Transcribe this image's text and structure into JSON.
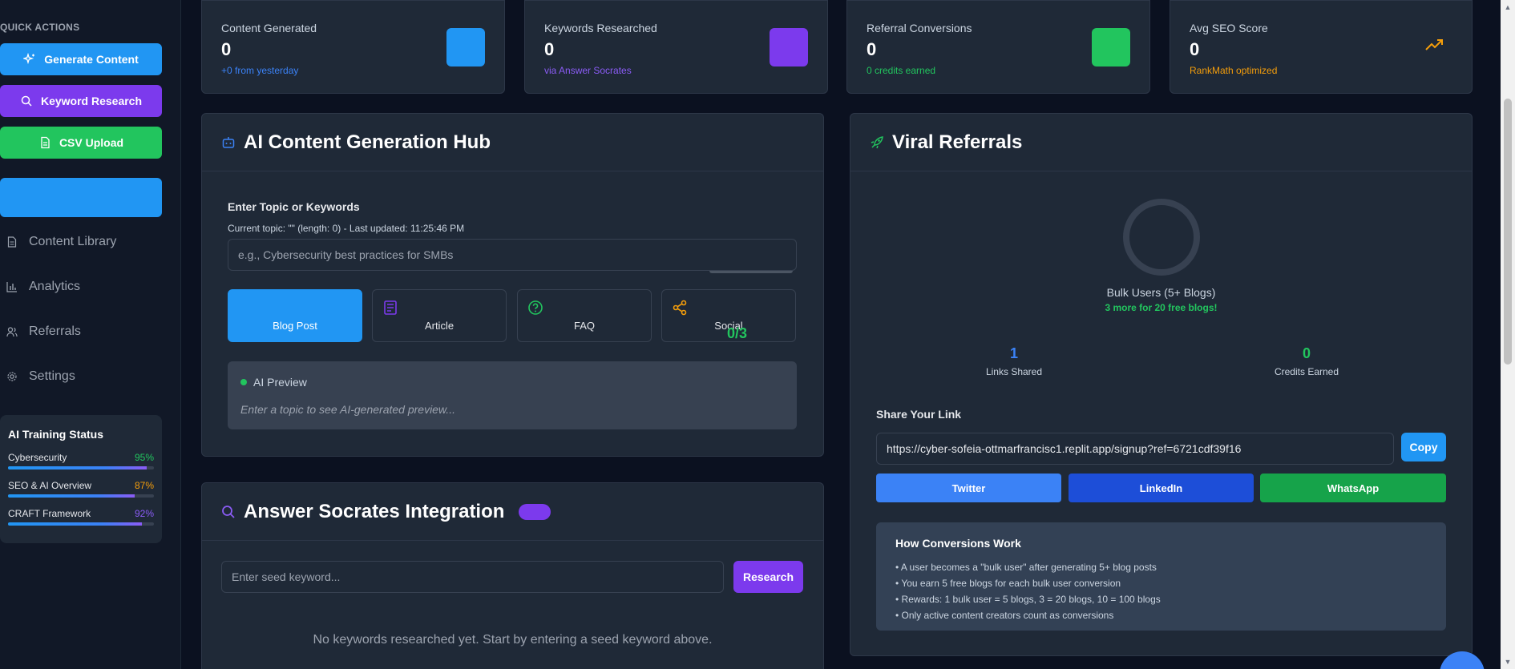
{
  "sidebar": {
    "quick_actions_title": "QUICK ACTIONS",
    "buttons": [
      {
        "label": "Generate Content",
        "icon": "sparkles-icon"
      },
      {
        "label": "Keyword Research",
        "icon": "search-icon"
      },
      {
        "label": "CSV Upload",
        "icon": "file-icon"
      },
      {
        "label": "",
        "icon": ""
      }
    ],
    "nav": [
      {
        "label": "Content Library",
        "icon": "document-icon"
      },
      {
        "label": "Analytics",
        "icon": "bar-chart-icon"
      },
      {
        "label": "Referrals",
        "icon": "users-icon"
      },
      {
        "label": "Settings",
        "icon": "gear-icon"
      }
    ],
    "training": {
      "title": "AI Training Status",
      "items": [
        {
          "label": "Cybersecurity",
          "value": "95%",
          "color": "#22c55e",
          "fill": 0.95
        },
        {
          "label": "SEO & AI Overview",
          "value": "87%",
          "color": "#f59e0b",
          "fill": 0.87
        },
        {
          "label": "CRAFT Framework",
          "value": "92%",
          "color": "#8b5cf6",
          "fill": 0.92
        }
      ]
    }
  },
  "stats": [
    {
      "label": "Content Generated",
      "value": "0",
      "sub": "+0 from yesterday",
      "sub_color": "#3b82f6",
      "accent": "#2196f3"
    },
    {
      "label": "Keywords Researched",
      "value": "0",
      "sub": "via Answer Socrates",
      "sub_color": "#8b5cf6",
      "accent": "#7c3aed"
    },
    {
      "label": "Referral Conversions",
      "value": "0",
      "sub": "0 credits earned",
      "sub_color": "#22c55e",
      "accent": "#22c55e"
    },
    {
      "label": "Avg SEO Score",
      "value": "0",
      "sub": "RankMath optimized",
      "sub_color": "#f59e0b",
      "accent": "#f59e0b"
    }
  ],
  "hub": {
    "title": "AI Content Generation Hub",
    "field_label": "Enter Topic or Keywords",
    "current_topic": "Current topic: \"\" (length: 0) - Last updated: 11:25:46 PM",
    "placeholder": "e.g., Cybersecurity best practices for SMBs",
    "types": [
      {
        "label": "Blog Post",
        "icon": ""
      },
      {
        "label": "Article",
        "icon": "newspaper-icon"
      },
      {
        "label": "FAQ",
        "icon": "question-circle-icon"
      },
      {
        "label": "Social",
        "icon": "share-icon"
      }
    ],
    "counter": "0/3",
    "preview_title": "AI Preview",
    "preview_text": "Enter a topic to see AI-generated preview..."
  },
  "socrates": {
    "title": "Answer Socrates Integration",
    "placeholder": "Enter seed keyword...",
    "button": "Research",
    "empty": "No keywords researched yet. Start by entering a seed keyword above."
  },
  "referrals": {
    "title": "Viral Referrals",
    "ring_label": "Bulk Users (5+ Blogs)",
    "ring_sub": "3 more for 20 free blogs!",
    "links_shared_value": "1",
    "links_shared_label": "Links Shared",
    "credits_value": "0",
    "credits_label": "Credits Earned",
    "share_label": "Share Your Link",
    "link": "https://cyber-sofeia-ottmarfrancisc1.replit.app/signup?ref=6721cdf39f16",
    "copy": "Copy",
    "twitter": "Twitter",
    "linkedin": "LinkedIn",
    "whatsapp": "WhatsApp",
    "how_title": "How Conversions Work",
    "how_items": [
      "• A user becomes a \"bulk user\" after generating 5+ blog posts",
      "• You earn 5 free blogs for each bulk user conversion",
      "• Rewards: 1 bulk user = 5 blogs, 3 = 20 blogs, 10 = 100 blogs",
      "• Only active content creators count as conversions"
    ]
  }
}
